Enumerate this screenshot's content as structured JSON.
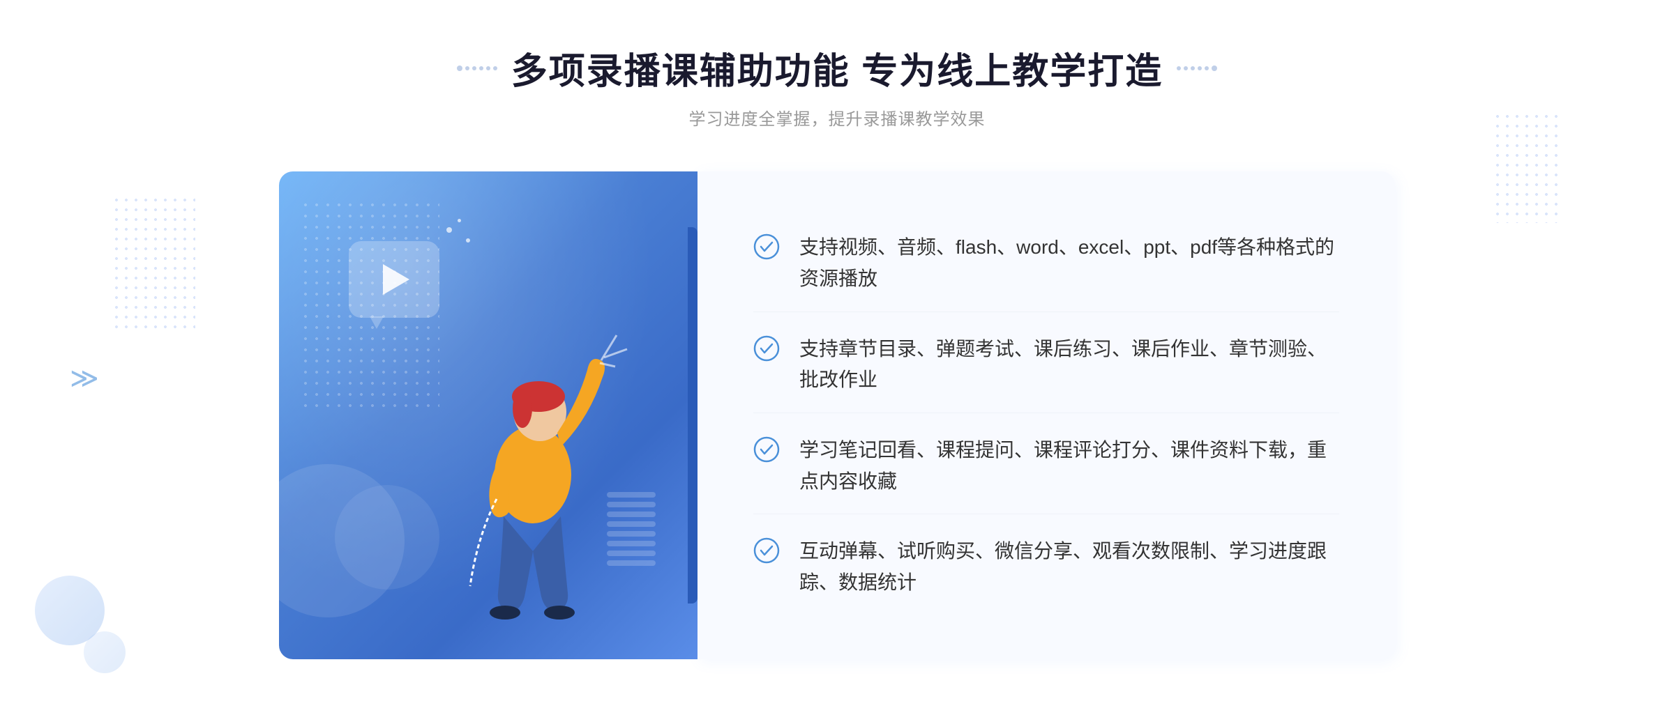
{
  "header": {
    "title": "多项录播课辅助功能 专为线上教学打造",
    "subtitle": "学习进度全掌握，提升录播课教学效果",
    "title_decoration_left": ":::::",
    "title_decoration_right": ":::::"
  },
  "features": [
    {
      "id": 1,
      "text": "支持视频、音频、flash、word、excel、ppt、pdf等各种格式的资源播放"
    },
    {
      "id": 2,
      "text": "支持章节目录、弹题考试、课后练习、课后作业、章节测验、批改作业"
    },
    {
      "id": 3,
      "text": "学习笔记回看、课程提问、课程评论打分、课件资料下载，重点内容收藏"
    },
    {
      "id": 4,
      "text": "互动弹幕、试听购买、微信分享、观看次数限制、学习进度跟踪、数据统计"
    }
  ],
  "colors": {
    "accent_blue": "#4a7fd4",
    "light_blue": "#6eb3f7",
    "check_color": "#4a90d9",
    "text_dark": "#1a1a2e",
    "text_gray": "#999999"
  }
}
